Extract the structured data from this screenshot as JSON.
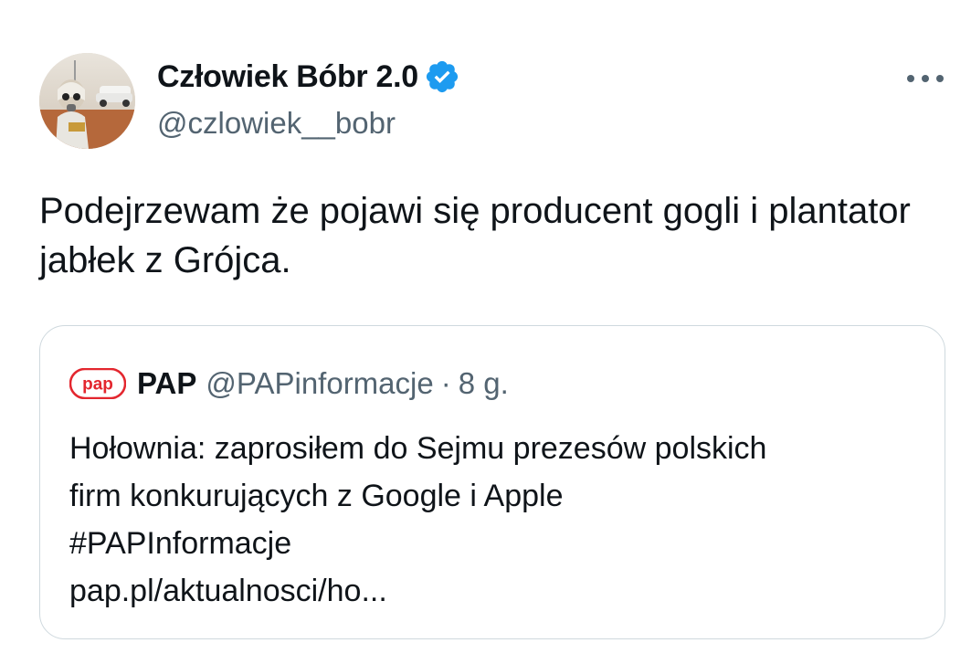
{
  "tweet": {
    "author": {
      "display_name": "Człowiek Bóbr 2.0",
      "handle": "@czlowiek__bobr",
      "verified_icon": "verified-badge-icon",
      "avatar_icon": "avatar-image"
    },
    "more_icon": "more-options-icon",
    "text": "Podejrzewam że pojawi się producent gogli i plantator jabłek z Grójca."
  },
  "quote": {
    "logo_text": "pap",
    "name": "PAP",
    "handle": "@PAPinformacje",
    "separator": "·",
    "time": "8 g.",
    "lines": [
      "Hołownia: zaprosiłem do Sejmu prezesów polskich",
      "firm konkurujących z Google i Apple",
      "#PAPInformacje",
      "pap.pl/aktualnosci/ho..."
    ]
  },
  "colors": {
    "text": "#0f1419",
    "secondary": "#536471",
    "border": "#cfd9de",
    "verified": "#1d9bf0",
    "pap_red": "#e3262e"
  }
}
